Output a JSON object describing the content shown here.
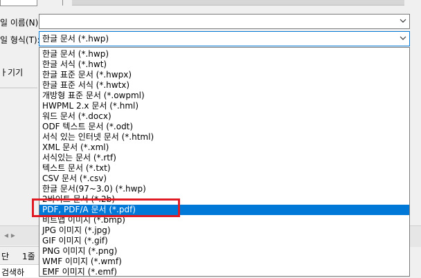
{
  "dialog": {
    "filename_label": "일 이름(N):",
    "filename_value": "",
    "filetype_label": "일 형식(T):",
    "filetype_selected": "한글 문서 (*.hwp)",
    "left_cut_text": "ㅏ기기"
  },
  "file_types": [
    "한글 문서 (*.hwp)",
    "한글 서식 (*.hwt)",
    "한글 표준 문서 (*.hwpx)",
    "한글 표준 서식 (*.hwtx)",
    "개방형 표준 문서 (*.owpml)",
    "HWPML 2.x 문서 (*.hml)",
    "워드 문서 (*.docx)",
    "ODF 텍스트 문서 (*.odt)",
    "서식 있는 인터넷 문서 (*.html)",
    "XML 문서 (*.xml)",
    "서식있는 문서 (*.rtf)",
    "텍스트 문서 (*.txt)",
    "CSV 문서 (*.csv)",
    "한글 문서(97~3.0) (*.hwp)",
    "2바이트 문서 (*.2b)",
    "PDF, PDF/A 문서 (*.pdf)",
    "비트맵 이미지 (*.bmp)",
    "JPG 이미지 (*.jpg)",
    "GIF 이미지 (*.gif)",
    "PNG 이미지 (*.png)",
    "WMF 이미지 (*.wmf)",
    "EMF 이미지 (*.emf)"
  ],
  "selected_index": 15,
  "background_app": {
    "row1_text": "단",
    "row1_text2": "1줄",
    "row3_text": "검색하"
  }
}
